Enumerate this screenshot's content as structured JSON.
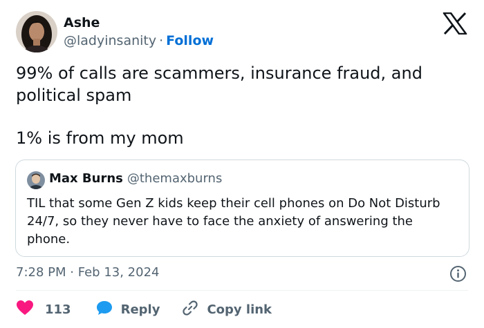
{
  "author": {
    "name": "Ashe",
    "handle": "@ladyinsanity",
    "separator": "·",
    "follow_label": "Follow"
  },
  "tweet": {
    "line1": "99% of calls are scammers, insurance fraud, and political spam",
    "line2": "1% is from my mom"
  },
  "quoted": {
    "name": "Max Burns",
    "handle": "@themaxburns",
    "text": "TIL that some Gen Z kids keep their cell phones on Do Not Disturb 24/7, so they never have to face the anxiety of answering the phone."
  },
  "meta": {
    "time": "7:28 PM",
    "separator": "·",
    "date": "Feb 13, 2024"
  },
  "actions": {
    "like_count": "113",
    "reply_label": "Reply",
    "copy_link_label": "Copy link"
  },
  "colors": {
    "text": "#0f1419",
    "secondary": "#536471",
    "follow": "#006fd6",
    "like": "#f91880",
    "reply": "#1d9bf0",
    "border": "#cfd9de"
  },
  "icons": {
    "brand": "x-logo-icon",
    "like": "heart-icon",
    "reply": "speech-bubble-icon",
    "copy": "link-icon",
    "info": "info-icon"
  }
}
